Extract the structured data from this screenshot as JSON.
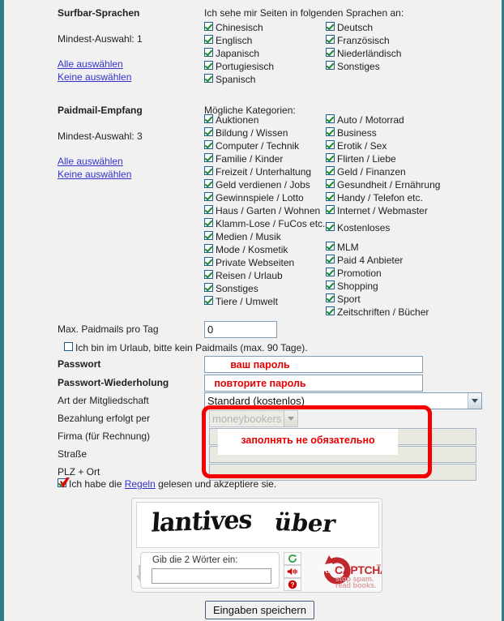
{
  "theme": {
    "page_bg": "#f1f1f1",
    "border_accent": "#2e7d86",
    "link": "#3333cc",
    "annotation_red": "#e60000",
    "checkbox_check": "#1a8a2a"
  },
  "surfbar": {
    "title": "Surfbar-Sprachen",
    "min_selection": "Mindest-Auswahl: 1",
    "select_all": "Alle auswählen",
    "select_none": "Keine auswählen",
    "heading": "Ich sehe mir Seiten in folgenden Sprachen an:",
    "languages_col1": [
      {
        "label": "Chinesisch",
        "checked": true
      },
      {
        "label": "Englisch",
        "checked": true
      },
      {
        "label": "Japanisch",
        "checked": true
      },
      {
        "label": "Portugiesisch",
        "checked": true
      },
      {
        "label": "Spanisch",
        "checked": true
      }
    ],
    "languages_col2": [
      {
        "label": "Deutsch",
        "checked": true
      },
      {
        "label": "Französisch",
        "checked": true
      },
      {
        "label": "Niederländisch",
        "checked": true
      },
      {
        "label": "Sonstiges",
        "checked": true
      }
    ]
  },
  "paidmail": {
    "title": "Paidmail-Empfang",
    "min_selection": "Mindest-Auswahl: 3",
    "select_all": "Alle auswählen",
    "select_none": "Keine auswählen",
    "heading": "Mögliche Kategorien:",
    "categories_col1": [
      {
        "label": "Auktionen",
        "checked": true
      },
      {
        "label": "Bildung / Wissen",
        "checked": true
      },
      {
        "label": "Computer / Technik",
        "checked": true
      },
      {
        "label": "Familie / Kinder",
        "checked": true
      },
      {
        "label": "Freizeit / Unterhaltung",
        "checked": true
      },
      {
        "label": "Geld verdienen / Jobs",
        "checked": true
      },
      {
        "label": "Gewinnspiele / Lotto",
        "checked": true
      },
      {
        "label": "Haus / Garten / Wohnen",
        "checked": true
      },
      {
        "label": "Klamm-Lose / FuCos etc.",
        "checked": true
      },
      {
        "label": "Medien / Musik",
        "checked": true
      },
      {
        "label": "Mode / Kosmetik",
        "checked": true
      },
      {
        "label": "Private Webseiten",
        "checked": true
      },
      {
        "label": "Reisen / Urlaub",
        "checked": true
      },
      {
        "label": "Sonstiges",
        "checked": true
      },
      {
        "label": "Tiere / Umwelt",
        "checked": true
      }
    ],
    "categories_col2": [
      {
        "label": "Auto / Motorrad",
        "checked": true
      },
      {
        "label": "Business",
        "checked": true
      },
      {
        "label": "Erotik / Sex",
        "checked": true
      },
      {
        "label": "Flirten / Liebe",
        "checked": true
      },
      {
        "label": "Geld / Finanzen",
        "checked": true
      },
      {
        "label": "Gesundheit / Ernährung",
        "checked": true
      },
      {
        "label": "Handy / Telefon etc.",
        "checked": true
      },
      {
        "label": "Internet / Webmaster",
        "checked": true
      },
      {
        "label": "Kostenloses",
        "checked": true
      },
      {
        "label": "MLM",
        "checked": true
      },
      {
        "label": "Paid 4 Anbieter",
        "checked": true
      },
      {
        "label": "Promotion",
        "checked": true
      },
      {
        "label": "Shopping",
        "checked": true
      },
      {
        "label": "Sport",
        "checked": true
      },
      {
        "label": "Zeitschriften / Bücher",
        "checked": true
      }
    ]
  },
  "form": {
    "max_paidmails_label": "Max. Paidmails pro Tag",
    "max_paidmails_value": "0",
    "vacation_label": "Ich bin im Urlaub, bitte kein Paidmails (max. 90 Tage).",
    "vacation_checked": false,
    "password_label": "Passwort",
    "password_value": "",
    "password_repeat_label": "Passwort-Wiederholung",
    "password_repeat_value": "",
    "membership_label": "Art der Mitgliedschaft",
    "membership_value": "Standard (kostenlos)",
    "membership_options": [
      "Standard (kostenlos)"
    ],
    "payment_label": "Bezahlung erfolgt per",
    "payment_value": "moneybookers",
    "payment_options": [
      "moneybookers"
    ],
    "company_label": "Firma (für Rechnung)",
    "company_value": "",
    "street_label": "Straße",
    "street_value": "",
    "zip_city_label": "PLZ + Ort",
    "zip_city_value": "",
    "rules_prefix": "Ich habe die ",
    "rules_link": "Regeln",
    "rules_suffix": " gelesen und akzeptiere sie.",
    "rules_checked": true
  },
  "annotations": {
    "password_hint": "ваш пароль",
    "password_repeat_hint": "повторите пароль",
    "optional_hint": "заполнять не обязательно"
  },
  "captcha": {
    "word1": "lantives",
    "word2": "über",
    "prompt": "Gib die 2 Wörter ein:",
    "input_value": "",
    "brand_re": "Re",
    "brand_captcha": "CAPTCHA",
    "brand_tm": "™",
    "tagline_line1": "stop spam.",
    "tagline_line2": "read books."
  },
  "submit": {
    "label": "Eingaben speichern"
  }
}
